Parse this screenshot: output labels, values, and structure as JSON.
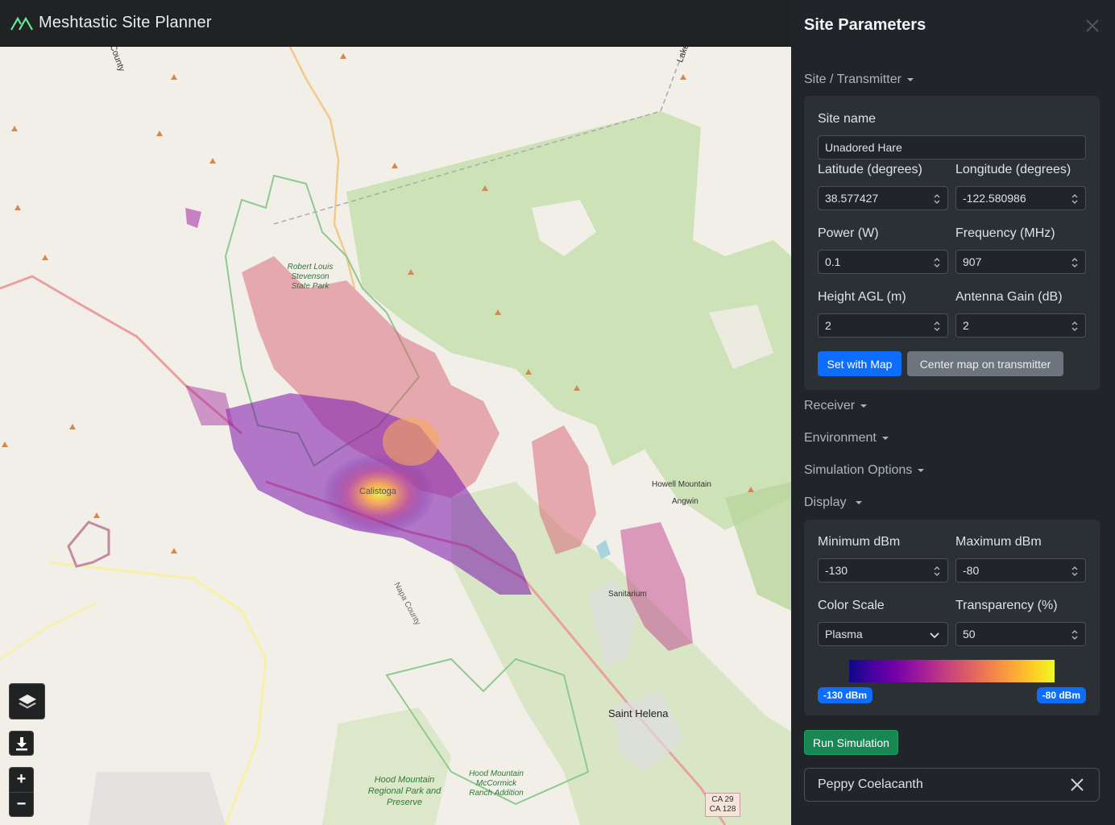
{
  "app": {
    "title": "Meshtastic Site Planner"
  },
  "map": {
    "labels": {
      "county_top": "County",
      "lake": "Lake",
      "park_rls": "Robert Louis Stevenson State Park",
      "calistoga": "Calistoga",
      "napa_county": "Napa County",
      "howell_mountain": "Howell Mountain",
      "angwin": "Angwin",
      "sanitarium": "Sanitarium",
      "saint_helena": "Saint Helena",
      "hood_mountain_park": "Hood Mountain Regional Park and Preserve",
      "hood_mountain_ranch": "Hood Mountain McCormick Ranch Addition",
      "shield_line1": "CA 29",
      "shield_line2": "CA 128"
    },
    "controls": {
      "zoom_in": "+",
      "zoom_out": "−"
    }
  },
  "sidebar": {
    "title": "Site Parameters",
    "sections": {
      "site": "Site / Transmitter",
      "receiver": "Receiver",
      "environment": "Environment",
      "simulation": "Simulation Options",
      "display": "Display"
    },
    "transmitter": {
      "site_name_label": "Site name",
      "site_name_value": "Unadored Hare",
      "lat_label": "Latitude (degrees)",
      "lat_value": "38.577427",
      "lon_label": "Longitude (degrees)",
      "lon_value": "-122.580986",
      "power_label": "Power (W)",
      "power_value": "0.1",
      "freq_label": "Frequency (MHz)",
      "freq_value": "907",
      "height_label": "Height AGL (m)",
      "height_value": "2",
      "gain_label": "Antenna Gain (dB)",
      "gain_value": "2",
      "set_with_map": "Set with Map",
      "center_map": "Center map on transmitter"
    },
    "display": {
      "min_label": "Minimum dBm",
      "min_value": "-130",
      "max_label": "Maximum dBm",
      "max_value": "-80",
      "scale_label": "Color Scale",
      "scale_value": "Plasma",
      "transp_label": "Transparency (%)",
      "transp_value": "50",
      "badge_min": "-130 dBm",
      "badge_max": "-80 dBm"
    },
    "run_simulation": "Run Simulation",
    "site_card": "Peppy Coelacanth"
  }
}
